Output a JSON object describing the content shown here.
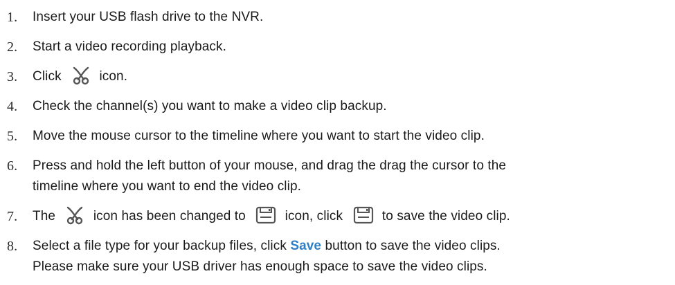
{
  "steps": [
    {
      "number": "1.",
      "text": "Insert your USB flash drive to the NVR."
    },
    {
      "number": "2.",
      "text": "Start a video recording playback."
    },
    {
      "number": "3.",
      "before": "Click",
      "icon": "scissors-icon",
      "after": "icon."
    },
    {
      "number": "4.",
      "text": "Check the channel(s) you want to make a video clip backup."
    },
    {
      "number": "5.",
      "text": "Move the mouse cursor to the timeline where you want to start the video clip."
    },
    {
      "number": "6.",
      "line1": "Press and hold the left button of your mouse, and drag the drag the cursor to the",
      "line2": "timeline where you want to end the video clip."
    },
    {
      "number": "7.",
      "part1": "The",
      "icon1": "scissors-icon",
      "part2": "icon has been changed to",
      "icon2": "save-icon",
      "part3": "icon, click",
      "icon3": "save-icon",
      "part4": "to save the video clip."
    },
    {
      "number": "8.",
      "before": "Select a file type for your backup files, click",
      "bold": "Save",
      "after": "button to save the video clips.",
      "line2": "Please make sure your USB driver has enough space to save the video clips."
    }
  ],
  "colors": {
    "text": "#1a1a1a",
    "highlight": "#2f7fc6",
    "icon_stroke": "#555555"
  }
}
